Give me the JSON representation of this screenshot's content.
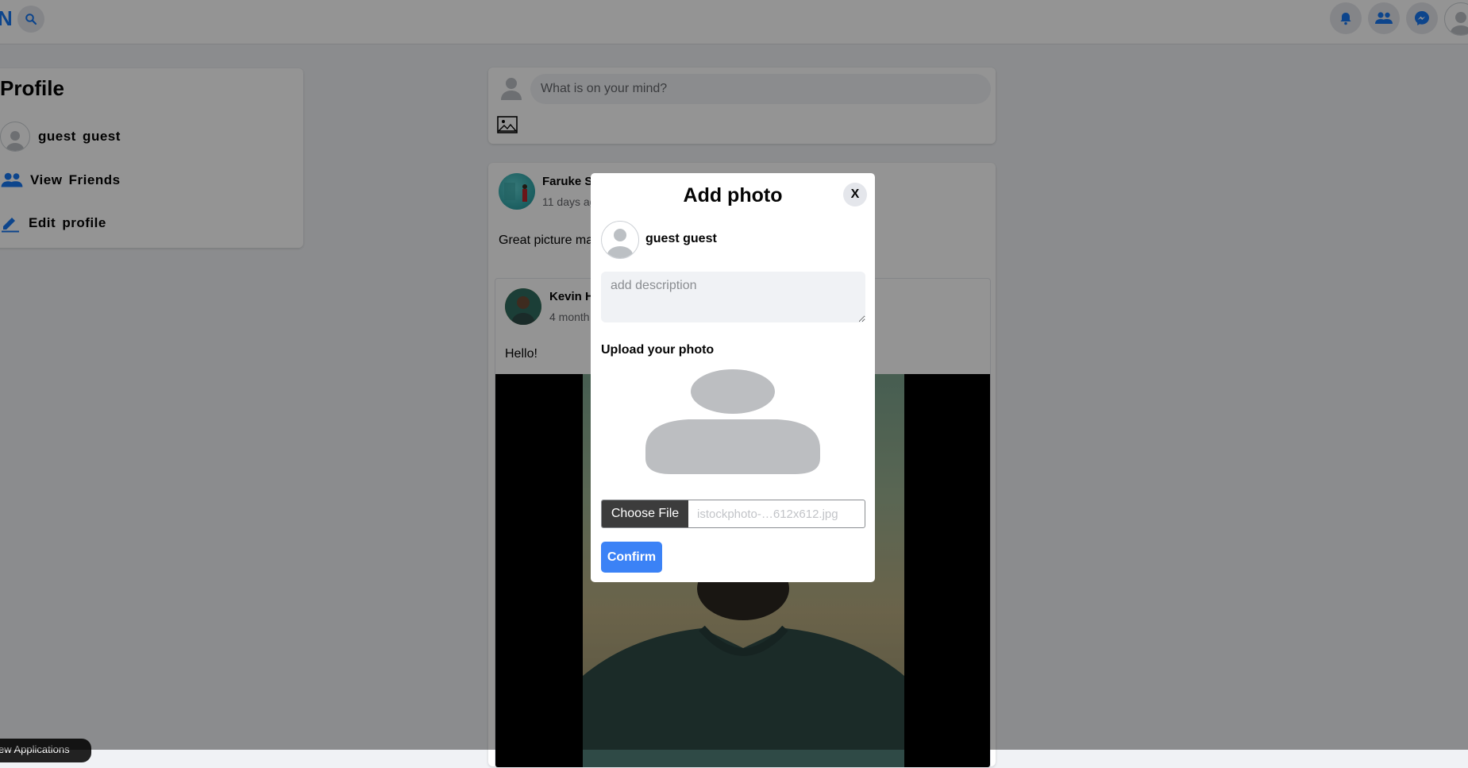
{
  "navbar": {
    "logo": "N",
    "icons": [
      "search-icon",
      "bell-icon",
      "friends-icon",
      "messenger-icon",
      "account-avatar"
    ]
  },
  "sidebar": {
    "title": "Profile",
    "user_name": "guest  guest",
    "view_friends": "View  Friends",
    "edit_profile": "Edit  profile"
  },
  "composer": {
    "placeholder": "What is on your mind?"
  },
  "feed": {
    "post": {
      "author": "Faruke Sp",
      "time": "11 days ag",
      "text": "Great picture ma",
      "shared": {
        "author": "Kevin H",
        "time": "4 month",
        "text": "Hello!"
      }
    }
  },
  "modal": {
    "title": "Add photo",
    "close_label": "X",
    "user_name": "guest guest",
    "description_placeholder": "add description",
    "upload_label": "Upload your photo",
    "choose_file_label": "Choose File",
    "file_name": "istockphoto-…612x612.jpg",
    "confirm_label": "Confirm"
  },
  "toast": {
    "text": "ew Applications"
  },
  "colors": {
    "brand": "#1877f2",
    "confirm": "#3b82f6",
    "overlay": "rgba(0,0,0,0.42)"
  }
}
